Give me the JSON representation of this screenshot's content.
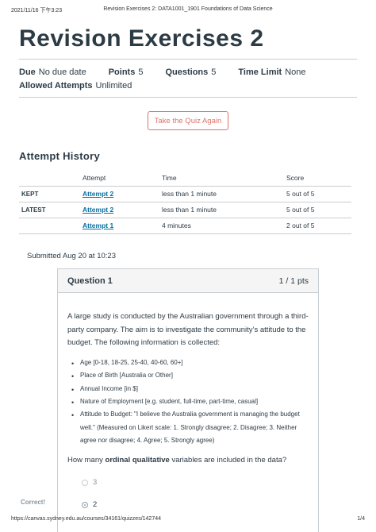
{
  "print_header": {
    "date": "2021/11/16 下午3:23",
    "title": "Revision Exercises 2: DATA1001_1901 Foundations of Data Science"
  },
  "page_title": "Revision Exercises 2",
  "meta": {
    "due_label": "Due",
    "due_value": "No due date",
    "points_label": "Points",
    "points_value": "5",
    "questions_label": "Questions",
    "questions_value": "5",
    "time_limit_label": "Time Limit",
    "time_limit_value": "None",
    "attempts_label": "Allowed Attempts",
    "attempts_value": "Unlimited"
  },
  "retake_button": "Take the Quiz Again",
  "history": {
    "title": "Attempt History",
    "headers": [
      "",
      "Attempt",
      "Time",
      "Score"
    ],
    "rows": [
      {
        "label": "KEPT",
        "attempt": "Attempt 2",
        "time": "less than 1 minute",
        "score": "5 out of 5"
      },
      {
        "label": "LATEST",
        "attempt": "Attempt 2",
        "time": "less than 1 minute",
        "score": "5 out of 5"
      },
      {
        "label": "",
        "attempt": "Attempt 1",
        "time": "4 minutes",
        "score": "2 out of 5"
      }
    ]
  },
  "submitted": "Submitted Aug 20 at 10:23",
  "question": {
    "name": "Question 1",
    "points": "1 / 1 pts",
    "intro": "A large study is conducted by the Australian government through a third-party company. The aim is to investigate the community’s attitude to the budget. The following information is collected:",
    "items": [
      "Age [0-18, 18-25, 25-40, 40-60, 60+]",
      "Place of Birth [Australia or Other]",
      "Annual Income [in $]",
      "Nature of Employment [e.g. student, full-time, part-time, casual]",
      "Attitude to Budget: \"I believe the Australia government is managing the budget well.\" (Measured on Likert scale: 1. Strongly disagree; 2. Disagree; 3. Neither agree nor disagree; 4. Agree; 5. Strongly agree)"
    ],
    "ask_prefix": "How many ",
    "ask_bold": "ordinal qualitative",
    "ask_suffix": " variables are included in the data?",
    "answers": [
      "3",
      "2"
    ],
    "correct_label": "Correct!"
  },
  "print_footer": {
    "url": "https://canvas.sydney.edu.au/courses/34161/quizzes/142744",
    "page": "1/4"
  }
}
